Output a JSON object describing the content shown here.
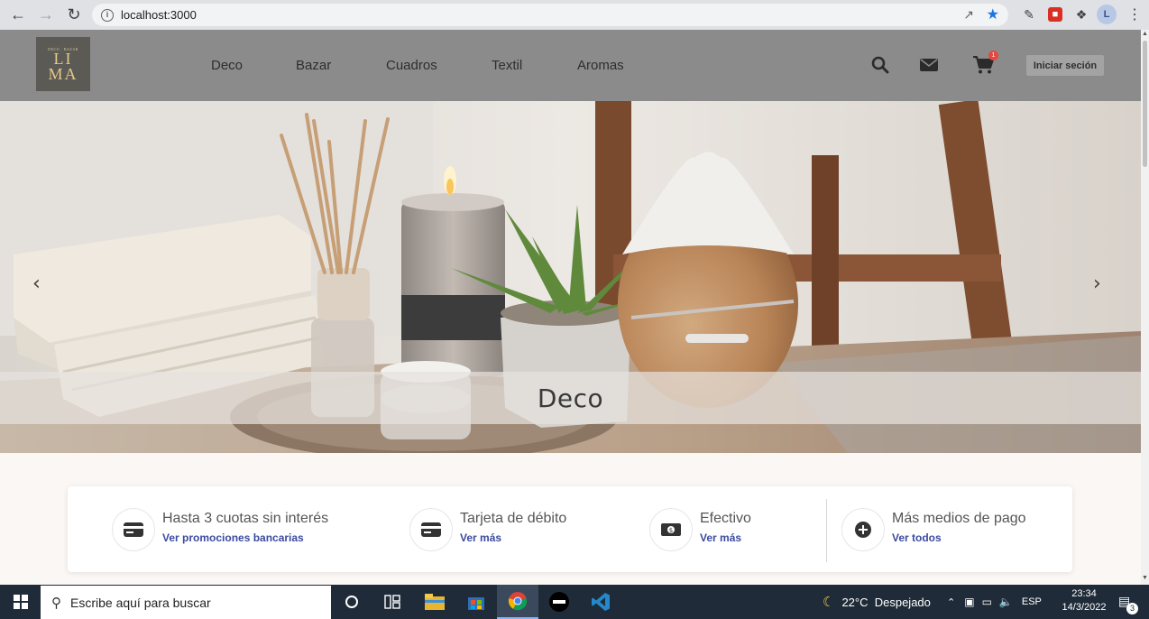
{
  "browser": {
    "url": "localhost:3000",
    "profile_initial": "L"
  },
  "site": {
    "logo": {
      "line1": "LI",
      "line2": "MA",
      "tagline": "DECO · BAZAR"
    },
    "menu": [
      "Deco",
      "Bazar",
      "Cuadros",
      "Textil",
      "Aromas"
    ],
    "cart_count": "1",
    "login_label": "Iniciar seción"
  },
  "hero": {
    "caption": "Deco",
    "prev_icon": "chevron-left-icon",
    "next_icon": "chevron-right-icon"
  },
  "payments": [
    {
      "title": "Hasta 3 cuotas sin interés",
      "link": "Ver promociones bancarias",
      "icon": "credit-card-icon"
    },
    {
      "title": "Tarjeta de débito",
      "link": "Ver más",
      "icon": "debit-card-icon"
    },
    {
      "title": "Efectivo",
      "link": "Ver más",
      "icon": "cash-icon"
    },
    {
      "title": "Más medios de pago",
      "link": "Ver todos",
      "icon": "plus-circle-icon"
    }
  ],
  "taskbar": {
    "search_placeholder": "Escribe aquí para buscar",
    "weather": "22°C  Despejado",
    "language": "ESP",
    "time": "23:34",
    "date": "14/3/2022",
    "notifications": "3"
  },
  "colors": {
    "header_bg": "#8b8b8b",
    "link_blue": "#3b4aa0",
    "badge_red": "#e8473f",
    "taskbar_bg": "#1f2b38"
  }
}
